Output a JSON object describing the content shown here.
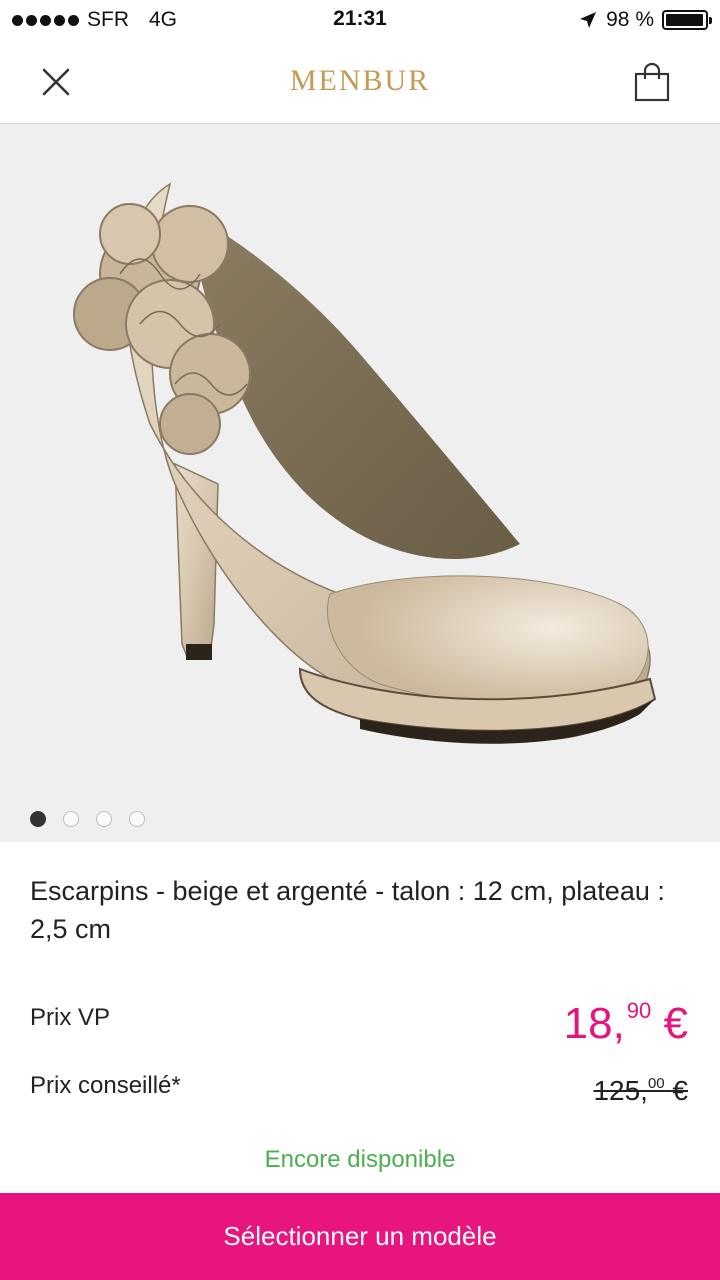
{
  "status_bar": {
    "carrier": "SFR",
    "network": "4G",
    "time": "21:31",
    "battery": "98 %",
    "battery_level": 0.98
  },
  "header": {
    "brand": "MENBUR",
    "close_icon": "close-icon",
    "cart_icon": "shopping-bag-icon"
  },
  "gallery": {
    "image_count": 4,
    "active_index": 0
  },
  "product": {
    "title": "Escarpins - beige et argenté - talon : 12 cm, plateau : 2,5 cm",
    "price_label": "Prix VP",
    "price_int": "18,",
    "price_cents": "90",
    "price_currency": "€",
    "rrp_label": "Prix conseillé*",
    "rrp_int": "125,",
    "rrp_cents": "00",
    "rrp_currency": "€",
    "availability": "Encore disponible"
  },
  "cta": {
    "label": "Sélectionner un modèle"
  },
  "colors": {
    "accent": "#e8157f",
    "price": "#e5157d",
    "brand": "#c49a55",
    "availability": "#4caf50"
  }
}
